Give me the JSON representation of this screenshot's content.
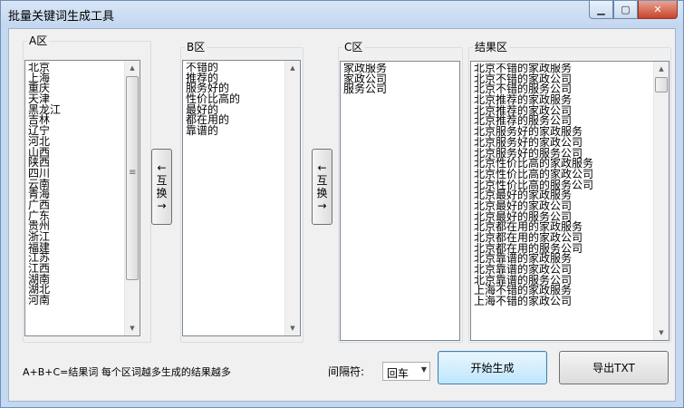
{
  "window": {
    "title": "批量关键词生成工具",
    "minimize": "▁",
    "maximize": "▢",
    "close": "✕"
  },
  "groups": {
    "a_label": "A区",
    "b_label": "B区",
    "c_label": "C区",
    "result_label": "结果区"
  },
  "lists": {
    "a": [
      "北京",
      "上海",
      "重庆",
      "天津",
      "黑龙江",
      "吉林",
      "辽宁",
      "河北",
      "山西",
      "陕西",
      "四川",
      "云南",
      "青海",
      "广西",
      "广东",
      "贵州",
      "浙江",
      "福建",
      "江苏",
      "江西",
      "湖南",
      "湖北",
      "河南"
    ],
    "b": [
      "不错的",
      "推荐的",
      "服务好的",
      "性价比高的",
      "最好的",
      "都在用的",
      "靠谱的"
    ],
    "c": [
      "家政服务",
      "家政公司",
      "服务公司"
    ],
    "result": [
      "北京不错的家政服务",
      "北京不错的家政公司",
      "北京不错的服务公司",
      "北京推荐的家政服务",
      "北京推荐的家政公司",
      "北京推荐的服务公司",
      "北京服务好的家政服务",
      "北京服务好的家政公司",
      "北京服务好的服务公司",
      "北京性价比高的家政服务",
      "北京性价比高的家政公司",
      "北京性价比高的服务公司",
      "北京最好的家政服务",
      "北京最好的家政公司",
      "北京最好的服务公司",
      "北京都在用的家政服务",
      "北京都在用的家政公司",
      "北京都在用的服务公司",
      "北京靠谱的家政服务",
      "北京靠谱的家政公司",
      "北京靠谱的服务公司",
      "上海不错的家政服务",
      "上海不错的家政公司"
    ]
  },
  "swap_button": {
    "arrow_left": "←",
    "char1": "互",
    "char2": "换",
    "arrow_right": "→"
  },
  "footer": {
    "note": "A+B+C=结果词 每个区词越多生成的结果越多",
    "separator_label": "间隔符:",
    "separator_value": "回车",
    "generate": "开始生成",
    "export": "导出TXT"
  },
  "icons": {
    "scroll_up": "▲",
    "scroll_down": "▼",
    "dropdown": "▼",
    "grip": "≡"
  }
}
